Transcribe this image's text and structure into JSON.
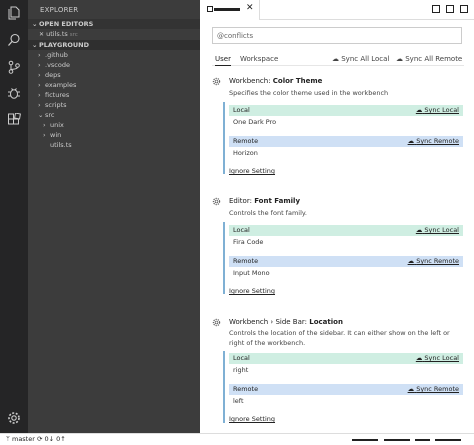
{
  "activity_bar": {
    "icons": [
      "files-icon",
      "search-icon",
      "source-control-icon",
      "debug-icon",
      "extensions-icon",
      "settings-gear-icon"
    ]
  },
  "explorer": {
    "title": "EXPLORER",
    "open_editors_header": "OPEN EDITORS",
    "open_editor_item": {
      "close": "✕",
      "name": "utils.ts",
      "folder": "src"
    },
    "playground_header": "PLAYGROUND",
    "tree": [
      {
        "label": ".github",
        "chevron": "›"
      },
      {
        "label": ".vscode",
        "chevron": "›"
      },
      {
        "label": "deps",
        "chevron": "›"
      },
      {
        "label": "examples",
        "chevron": "›"
      },
      {
        "label": "fictures",
        "chevron": "›"
      },
      {
        "label": "scripts",
        "chevron": "›"
      },
      {
        "label": "src",
        "chevron": "⌄"
      },
      {
        "label": "unix",
        "chevron": "›"
      },
      {
        "label": "win",
        "chevron": "›"
      },
      {
        "label": "utils.ts",
        "chevron": ""
      }
    ]
  },
  "editor": {
    "tab_close": "✕",
    "search": {
      "value": "@conflicts",
      "placeholder": ""
    },
    "tabs": {
      "user": "User",
      "workspace": "Workspace"
    },
    "sync_all_local": "Sync All Local",
    "sync_all_remote": "Sync All Remote",
    "settings": [
      {
        "prefix": "Workbench: ",
        "name": "Color Theme",
        "description": "Specifies the color theme used in the workbench",
        "local_label": "Local",
        "local_action": "Sync Local",
        "local_value": "One Dark Pro",
        "remote_label": "Remote",
        "remote_action": "Sync Remote",
        "remote_value": "Horizon",
        "ignore": "Ignore Setting"
      },
      {
        "prefix": "Editor: ",
        "name": "Font Family",
        "description": "Controls the font family.",
        "local_label": "Local",
        "local_action": "Sync Local",
        "local_value": "Fira Code",
        "remote_label": "Remote",
        "remote_action": "Sync Remote",
        "remote_value": "Input Mono",
        "ignore": "Ignore Setting"
      },
      {
        "prefix": "Workbench › Side Bar: ",
        "name": "Location",
        "description": "Controls the location of the sidebar. It can either show on the left or right of the workbench.",
        "local_label": "Local",
        "local_action": "Sync Local",
        "local_value": "right",
        "remote_label": "Remote",
        "remote_action": "Sync Remote",
        "remote_value": "left",
        "ignore": "Ignore Setting"
      }
    ]
  },
  "status": {
    "branch": "master",
    "sync": "⟳ 0↓ 0↑"
  },
  "colors": {
    "activity": "#252526",
    "sidebar": "#3c3c3c",
    "local": "#cfeee2",
    "remote": "#cfe0f5"
  }
}
